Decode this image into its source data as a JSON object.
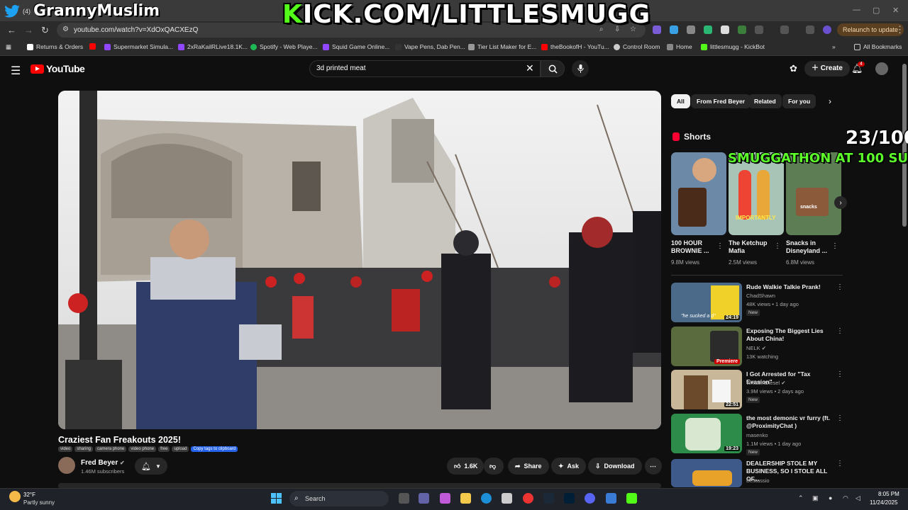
{
  "overlay": {
    "twitter_handle": "GrannyMuslim",
    "tab_count": "(4)",
    "kick_k": "K",
    "kick_rest": "ICK.COM/LITTLESMUGG",
    "sub_counter": "23/100",
    "sub_goal": "SMUGGATHON AT 100 SUBS!"
  },
  "browser": {
    "url": "youtube.com/watch?v=XdOxQACXEzQ",
    "relaunch_label": "Relaunch to update",
    "bookmarks": [
      "Returns & Orders",
      "Supermarket Simula...",
      "2xRaKailRLive18.1K...",
      "Spotify - Web Playe...",
      "Squid Game Online...",
      "Vape Pens, Dab Pen...",
      "Tier List Maker for E...",
      "theBookofH - YouTu...",
      "Control Room",
      "Home",
      "littlesmugg - KickBot"
    ],
    "all_bookmarks": "All Bookmarks"
  },
  "youtube": {
    "logo": "YouTube",
    "search_query": "3d printed meat",
    "create_label": "Create",
    "notif_count": "4"
  },
  "video": {
    "title": "Craziest Fan Freakouts 2025!",
    "tags": [
      "video",
      "sharing",
      "camera phone",
      "video phone",
      "free",
      "upload"
    ],
    "copy_tags": "Copy tags to clipboard",
    "channel": "Fred Beyer",
    "subscribers": "1.46M subscribers",
    "likes": "1.6K",
    "share": "Share",
    "ask": "Ask",
    "download": "Download"
  },
  "sidebar": {
    "chips": [
      "All",
      "From Fred Beyer",
      "Related",
      "For you"
    ],
    "shorts_label": "Shorts",
    "shorts": [
      {
        "title": "100 HOUR BROWNIE ...",
        "views": "9.8M views",
        "thumb_text": ""
      },
      {
        "title": "The Ketchup Mafia",
        "views": "2.5M views",
        "thumb_text": "IMPORTANTLY"
      },
      {
        "title": "Snacks in Disneyland ...",
        "views": "6.8M views",
        "thumb_text": "snacks"
      }
    ],
    "recommended": [
      {
        "title": "Rude Walkie Talkie Prank!",
        "channel": "ChadShawn",
        "meta": "48K views • 1 day ago",
        "badge": "New",
        "duration": "24:19",
        "caption": "\"he sucked a d\""
      },
      {
        "title": "Exposing The Biggest Lies About China!",
        "channel": "NELK",
        "meta": "13K watching",
        "badge": "",
        "duration": "Premiere",
        "caption": ""
      },
      {
        "title": "I Got Arrested for \"Tax Evasion\"",
        "channel": "WhistlinDiesel",
        "meta": "3.9M views • 2 days ago",
        "badge": "New",
        "duration": "22:51",
        "caption": ""
      },
      {
        "title": "the most demonic vr furry (ft. @ProximityChat )",
        "channel": "masenko",
        "meta": "1.1M views • 1 day ago",
        "badge": "New",
        "duration": "19:23",
        "caption": ""
      },
      {
        "title": "DEALERSHIP STOLE MY BUSINESS, SO I STOLE ALL OF...",
        "channel": "Bestassio",
        "meta": "",
        "badge": "",
        "duration": "",
        "caption": ""
      }
    ]
  },
  "taskbar": {
    "temp": "32°F",
    "condition": "Partly sunny",
    "search": "Search",
    "time": "8:05 PM",
    "date": "11/24/2025"
  }
}
